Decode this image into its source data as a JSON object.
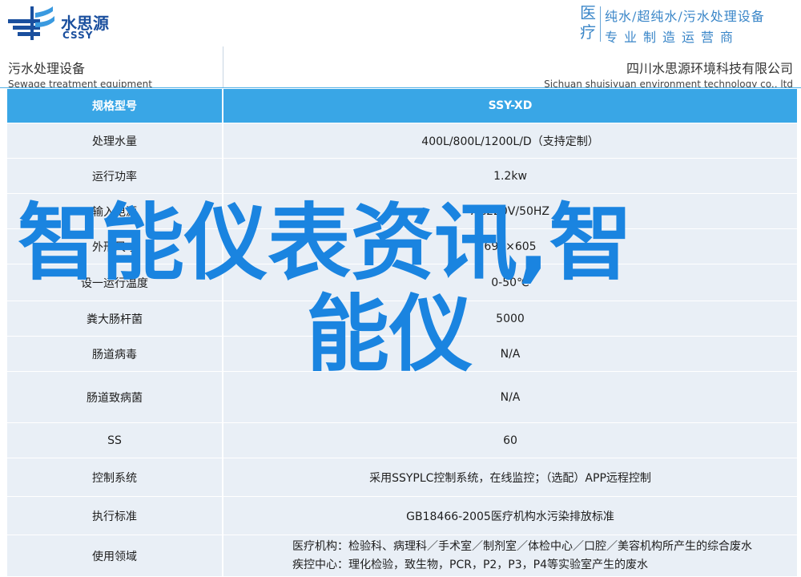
{
  "brand": {
    "name_cn": "水思源",
    "name_en": "CSSY",
    "accent": "#1a4f9e"
  },
  "slogan": {
    "mark_chars": [
      "医",
      "疗"
    ],
    "line1": "纯水/超纯水/污水处理设备",
    "line2": "专业制造运营商",
    "color": "#3a86c8"
  },
  "header": {
    "left_cn": "污水处理设备",
    "left_en": "Sewage treatment equipment",
    "right_cn": "四川水思源环境科技有限公司",
    "right_en": "Sichuan shuisiyuan environment technology co., ltd"
  },
  "table": {
    "header": {
      "label": "规格型号",
      "value": "SSY-XD",
      "color": "#39a6e6"
    },
    "rows": [
      {
        "label": "处理水量",
        "value": "400L/800L/1200L/D（支持定制）"
      },
      {
        "label": "运行功率",
        "value": "1.2kw"
      },
      {
        "label": "输入电源",
        "value": "AC220V/50HZ"
      },
      {
        "label": "外形尺寸",
        "value": "690×605"
      },
      {
        "label": "设一运行温度",
        "value": "0-50℃"
      },
      {
        "label": "粪大肠杆菌",
        "value": "5000"
      },
      {
        "label": "肠道病毒",
        "value": "N/A"
      },
      {
        "label": "肠道致病菌",
        "value": "N/A"
      },
      {
        "label": "SS",
        "value": "60"
      },
      {
        "label": "控制系统",
        "value": "采用SSYPLC控制系统，在线监控；（选配）APP远程控制"
      },
      {
        "label": "执行标准",
        "value": "GB18466-2005医疗机构水污染排放标准"
      },
      {
        "label": "使用领域",
        "value_lines": [
          "医疗机构：检验科、病理科／手术室／制剂室／体检中心／口腔／美容机构所产生的综合废水",
          "疾控中心：理化检验，致生物，PCR，P2，P3，P4等实验室产生的废水"
        ]
      }
    ],
    "row_bg": "#e9eff6"
  },
  "overlay": {
    "line1": "智能仪表资讯,智",
    "line2": "能仪",
    "color": "#1a84e0"
  }
}
